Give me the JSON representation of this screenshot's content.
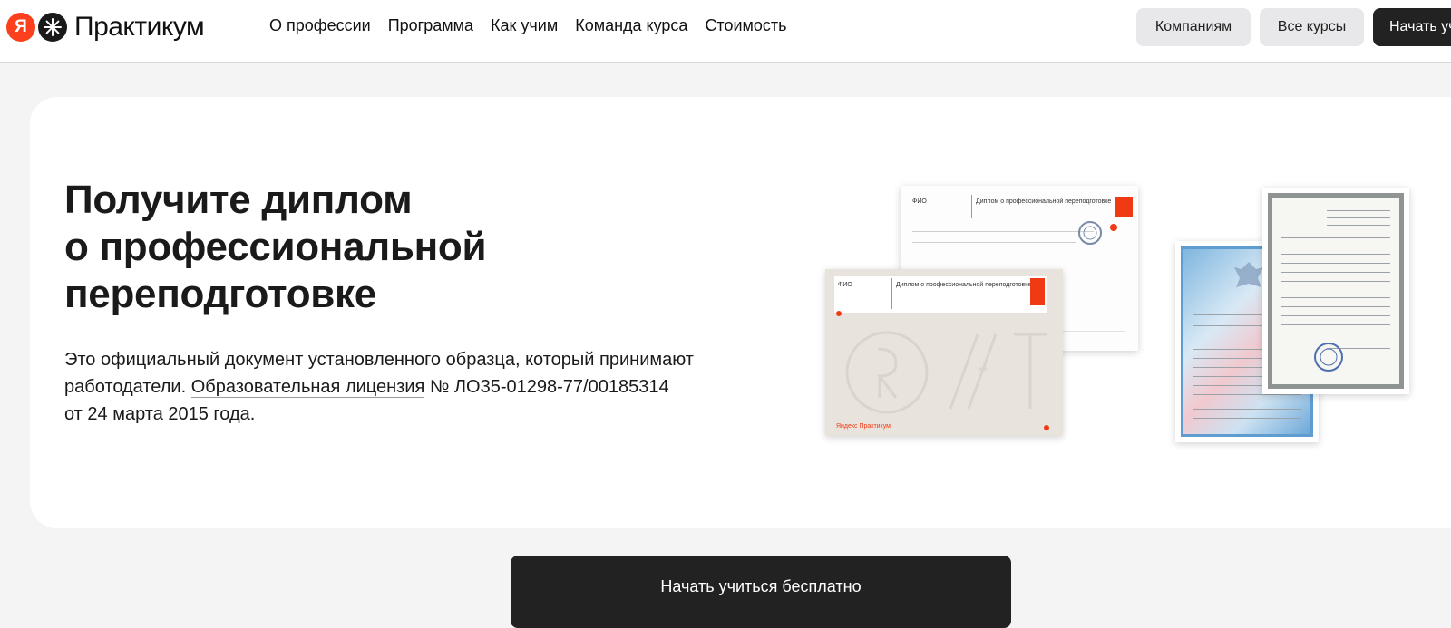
{
  "header": {
    "logo": {
      "mark_letter": "Я",
      "wordmark": "Практикум"
    },
    "nav": [
      {
        "label": "О профессии"
      },
      {
        "label": "Программа"
      },
      {
        "label": "Как учим"
      },
      {
        "label": "Команда курса"
      },
      {
        "label": "Стоимость"
      }
    ],
    "buttons": {
      "companies": "Компаниям",
      "all_courses": "Все курсы",
      "start": "Начать уч"
    }
  },
  "hero": {
    "title_lines": [
      "Получите диплом",
      "о профессиональной",
      "переподготовке"
    ],
    "description": {
      "before_link": "Это официальный документ установленного образца, который принимают работодатели. ",
      "link": "Образовательная лицензия",
      "after_link": " № ЛО35-01298-77/00185314",
      "line3": "от 24 марта 2015 года."
    }
  },
  "certificates": {
    "diploma_back": {
      "fio": "ФИО",
      "title": "Диплом о профессиональной переподготовке"
    },
    "diploma_front": {
      "fio": "ФИО",
      "title": "Диплом о профессиональной переподготовке",
      "brand": "Яндекс Практикум"
    }
  },
  "cta": {
    "label": "Начать учиться бесплатно"
  },
  "colors": {
    "brand_red": "#fc3f1d",
    "dark": "#222222",
    "header_button_bg": "#e8e8ea"
  }
}
